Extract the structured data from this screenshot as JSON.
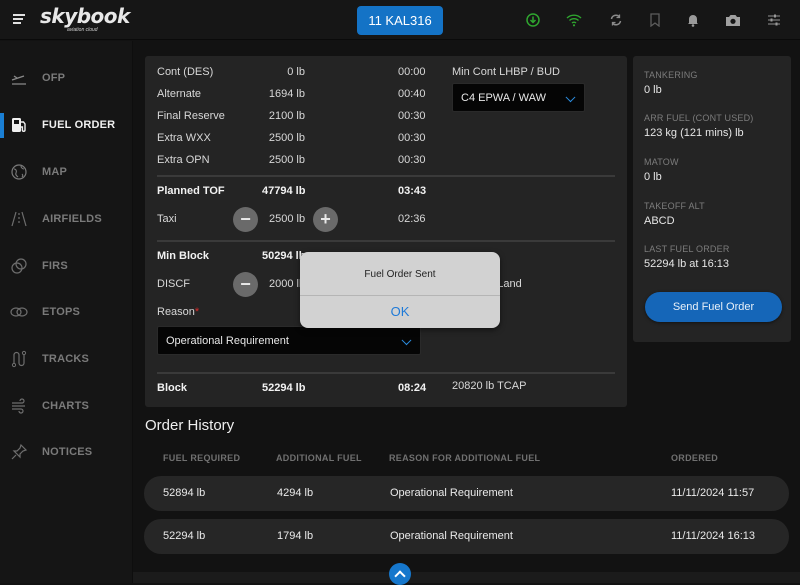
{
  "app": {
    "logo": "skybook",
    "logo_tagline": "aviation cloud",
    "flight_button": "11 KAL316"
  },
  "top_icons": [
    {
      "name": "download-icon",
      "color": "#2fa52f"
    },
    {
      "name": "wifi-icon",
      "color": "#2fa52f"
    },
    {
      "name": "sync-icon",
      "color": "#8a8a8a"
    },
    {
      "name": "bookmark-icon",
      "color": "#6a6a6a"
    },
    {
      "name": "bell-icon",
      "color": "#9a9a9a"
    },
    {
      "name": "camera-icon",
      "color": "#a0a0a0"
    },
    {
      "name": "sliders-icon",
      "color": "#8a8a8a"
    }
  ],
  "sidebar": {
    "items": [
      {
        "label": "OFP",
        "icon": "plane-takeoff-icon"
      },
      {
        "label": "FUEL ORDER",
        "icon": "fuel-pump-icon",
        "active": true
      },
      {
        "label": "MAP",
        "icon": "globe-icon"
      },
      {
        "label": "AIRFIELDS",
        "icon": "runway-icon"
      },
      {
        "label": "FIRS",
        "icon": "firs-icon"
      },
      {
        "label": "ETOPS",
        "icon": "etops-icon"
      },
      {
        "label": "TRACKS",
        "icon": "tracks-icon"
      },
      {
        "label": "CHARTS",
        "icon": "wind-icon"
      },
      {
        "label": "NOTICES",
        "icon": "pin-icon"
      }
    ]
  },
  "fuel": {
    "rows": [
      {
        "label": "Cont (DES)",
        "amount": "0 lb",
        "time": "00:00"
      },
      {
        "label": "Alternate",
        "amount": "1694 lb",
        "time": "00:40"
      },
      {
        "label": "Final Reserve",
        "amount": "2100 lb",
        "time": "00:30"
      },
      {
        "label": "Extra WXX",
        "amount": "2500 lb",
        "time": "00:30"
      },
      {
        "label": "Extra OPN",
        "amount": "2500 lb",
        "time": "00:30"
      }
    ],
    "min_cont_label": "Min Cont LHBP / BUD",
    "min_cont_value": "C4 EPWA / WAW",
    "planned_tof": {
      "label": "Planned TOF",
      "amount": "47794 lb",
      "time": "03:43"
    },
    "taxi": {
      "label": "Taxi",
      "amount": "2500 lb",
      "time": "02:36"
    },
    "min_block": {
      "label": "Min Block",
      "amount": "50294 lb"
    },
    "discf": {
      "label": "DISCF",
      "amount": "2000 lb",
      "land": "20820 lb Land"
    },
    "reason_label": "Reason",
    "reason_required": "*",
    "reason_value": "Operational Requirement",
    "block": {
      "label": "Block",
      "amount": "52294 lb",
      "time": "08:24",
      "tcap": "20820 lb TCAP"
    }
  },
  "info": {
    "items": [
      {
        "label": "TANKERING",
        "value": "0 lb"
      },
      {
        "label": "ARR FUEL (CONT USED)",
        "value": "123 kg (121 mins) lb"
      },
      {
        "label": "MATOW",
        "value": "0 lb"
      },
      {
        "label": "TAKEOFF ALT",
        "value": "ABCD"
      },
      {
        "label": "LAST FUEL ORDER",
        "value": "52294 lb at 16:13"
      }
    ],
    "send_button": "Send Fuel Order"
  },
  "history": {
    "title": "Order History",
    "columns": [
      "FUEL REQUIRED",
      "ADDITIONAL FUEL",
      "REASON FOR ADDITIONAL FUEL",
      "ORDERED"
    ],
    "rows": [
      {
        "fuel_required": "52894 lb",
        "additional": "4294 lb",
        "reason": "Operational Requirement",
        "ordered": "11/11/2024 11:57"
      },
      {
        "fuel_required": "52294 lb",
        "additional": "1794 lb",
        "reason": "Operational Requirement",
        "ordered": "11/11/2024 16:13"
      }
    ]
  },
  "alert": {
    "title": "Fuel Order Sent",
    "ok": "OK"
  },
  "colors": {
    "accent": "#1473c6",
    "active_indicator": "#1a7fd4",
    "status_green": "#2fa52f",
    "required": "#d92b2b"
  }
}
